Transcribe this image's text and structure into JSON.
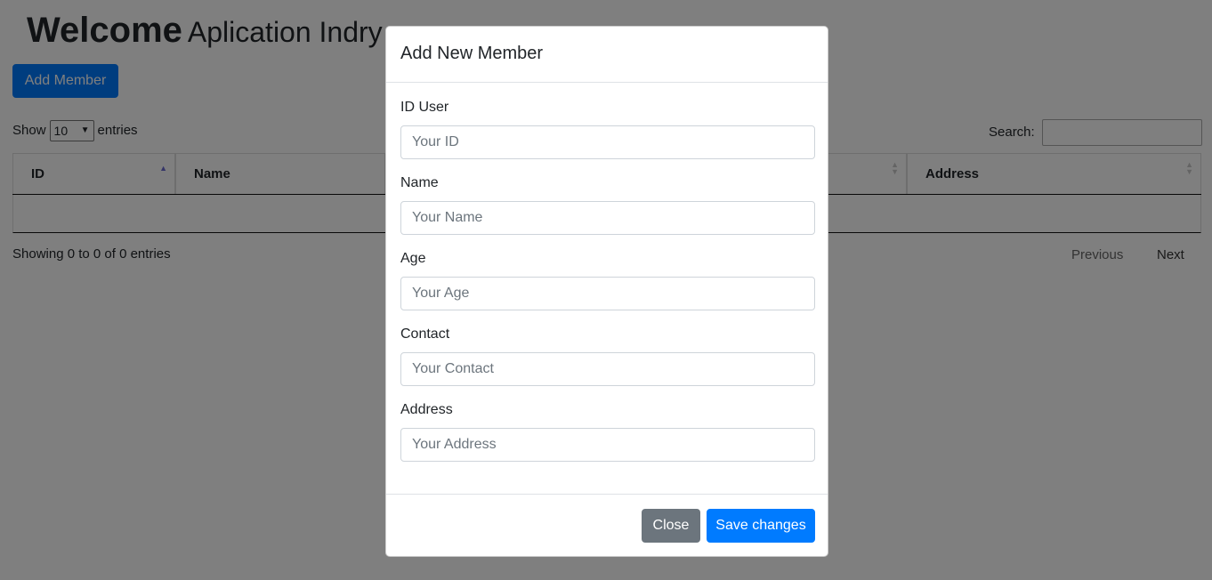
{
  "header": {
    "title_main": "Welcome",
    "title_sub": "Aplication Indry"
  },
  "toolbar": {
    "add_member_label": "Add Member"
  },
  "table_controls": {
    "show_label": "Show",
    "entries_value": "10",
    "entries_label": "entries",
    "search_label": "Search:"
  },
  "table": {
    "columns": [
      "ID",
      "Name",
      "",
      "",
      "Address"
    ],
    "rows": []
  },
  "footer": {
    "info": "Showing 0 to 0 of 0 entries",
    "previous": "Previous",
    "next": "Next"
  },
  "modal": {
    "title": "Add New Member",
    "fields": [
      {
        "label": "ID User",
        "placeholder": "Your ID"
      },
      {
        "label": "Name",
        "placeholder": "Your Name"
      },
      {
        "label": "Age",
        "placeholder": "Your Age"
      },
      {
        "label": "Contact",
        "placeholder": "Your Contact"
      },
      {
        "label": "Address",
        "placeholder": "Your Address"
      }
    ],
    "close_label": "Close",
    "save_label": "Save changes"
  },
  "colors": {
    "primary": "#007bff",
    "secondary": "#6c757d",
    "backdrop": "rgba(0,0,0,0.5)"
  }
}
